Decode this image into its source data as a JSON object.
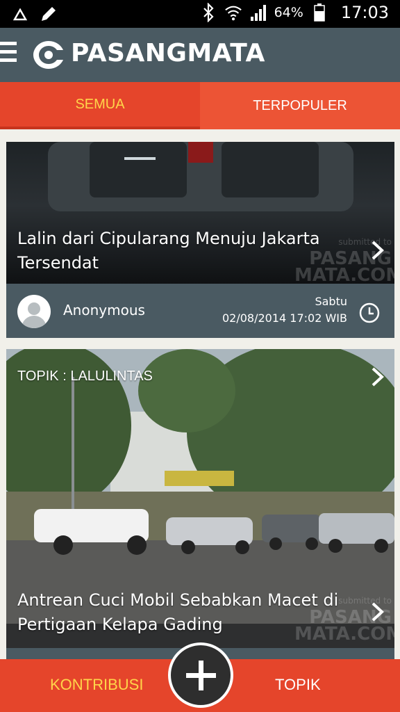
{
  "status_bar": {
    "battery": "64%",
    "time": "17:03",
    "icons": [
      "recycle-icon",
      "pencil-icon",
      "bluetooth-icon",
      "wifi-icon",
      "signal-icon",
      "battery-icon"
    ]
  },
  "header": {
    "logo_text": "PASANGMATA"
  },
  "tabs": [
    {
      "label": "SEMUA",
      "active": true
    },
    {
      "label": "TERPOPULER",
      "active": false
    }
  ],
  "posts": [
    {
      "caption": "Lalin dari Cipularang Menuju Jakarta Tersendat",
      "watermark_top": "submitted to",
      "watermark_brand": "PASANG MATA.COM",
      "author": "Anonymous",
      "day": "Sabtu",
      "datetime": "02/08/2014 17:02 WIB"
    },
    {
      "topic": "TOPIK : LALULINTAS",
      "caption": "Antrean Cuci Mobil Sebabkan Macet di Pertigaan Kelapa Gading",
      "watermark_top": "submitted to",
      "watermark_brand": "PASANG MATA.COM"
    }
  ],
  "bottom_bar": {
    "left_label": "KONTRIBUSI",
    "right_label": "TOPIK"
  },
  "colors": {
    "header": "#4a5a62",
    "accent": "#e5452b",
    "active_tab_text": "#ffd54a"
  }
}
